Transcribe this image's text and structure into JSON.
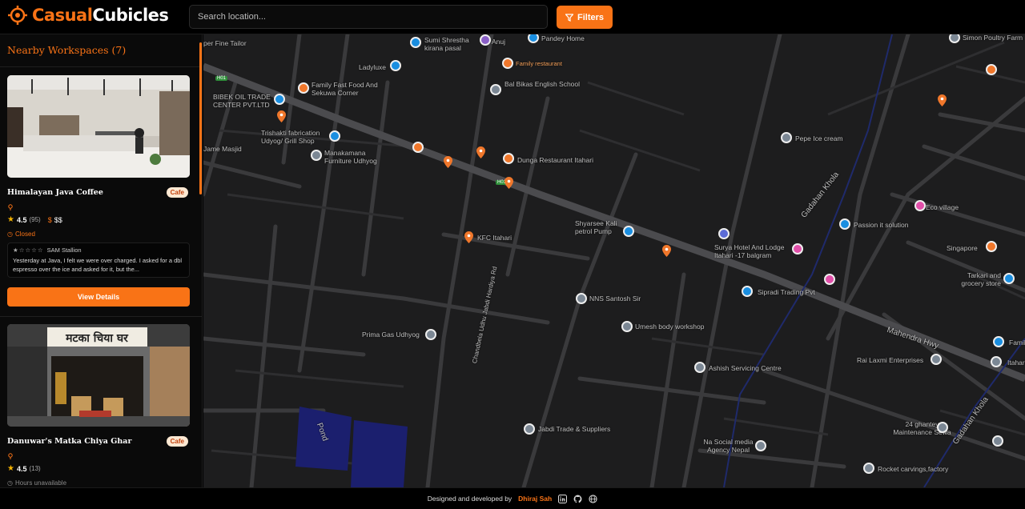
{
  "app": {
    "brand_part1": "Casual",
    "brand_part2": "Cubicles"
  },
  "header": {
    "search_placeholder": "Search location...",
    "filters_label": "Filters"
  },
  "sidebar": {
    "title": "Nearby Workspaces (7)",
    "cards": [
      {
        "name": "Himalayan Java Coffee",
        "badge": "Cafe",
        "rating": "4.5",
        "reviews_count": "(95)",
        "price": "$$",
        "status": "Closed",
        "review_author": "SAM Stallion",
        "review_text": "Yesterday at Java, I felt we were over charged. I asked for a dbl espresso over the ice and asked for it, but the...",
        "button": "View Details"
      },
      {
        "name": "Danuwar's Matka Chiya Ghar",
        "badge": "Cafe",
        "rating": "4.5",
        "reviews_count": "(13)",
        "status": "Hours unavailable",
        "sign_text": "मटका चिया घर"
      }
    ]
  },
  "map": {
    "labels": [
      "Sumi Shrestha kirana pasal",
      "Anuj",
      "Pandey Home",
      "per Fine Tailor",
      "Ladyluxe",
      "Family restaurant",
      "Family Fast Food And Sekuwa Corner",
      "Bal Bikas English School",
      "BIBEK OIL TRADE CENTER PVT.LTD",
      "Trishakti fabrication Udyog/ Grill Shop",
      "Jame Masjid",
      "Manakamana Furniture Udhyog",
      "Dunga Restaurant Itahari",
      "KFC Itahari",
      "Shyarsee Kali petrol Pump",
      "Surya Hotel And Lodge Itahari -17 balgram",
      "Sipradi Trading Pvt",
      "NNS Santosh Sir",
      "Umesh body workshop",
      "Prima Gas Udhyog",
      "Ashish Servicing Centre",
      "Jabdi Trade & Suppliers",
      "Na Social media Agency Nepal",
      "Rocket carvings,factory",
      "24 ghantey Maintenance Sewa",
      "Rai Laxmi Enterprises",
      "Pepe Ice cream",
      "Eco village",
      "Passion it solution",
      "Singapore",
      "Tarkari and grocery store",
      "Simon Poultry Farm",
      "Mahendra Hwy",
      "Gadahan Khola",
      "Pond",
      "Chandbela Udhu Jabdi Hardiya Rd",
      "Famil",
      "Itahari",
      "H01"
    ]
  },
  "footer": {
    "credit": "Designed and developed by",
    "author": "Dhiraj Sah"
  },
  "colors": {
    "accent": "#f97316",
    "background": "#000000",
    "map_bg": "#1d1d1e"
  }
}
